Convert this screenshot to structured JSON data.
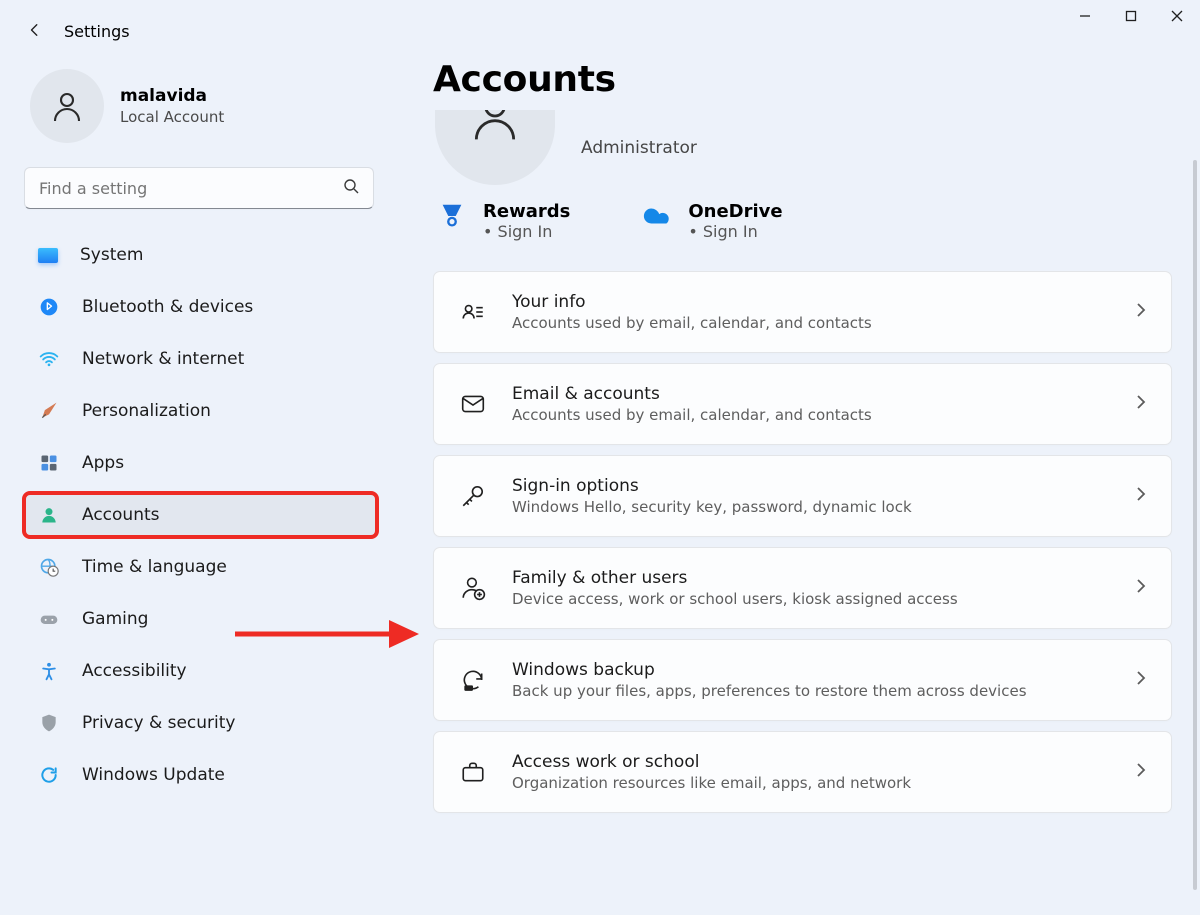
{
  "window": {
    "title": "Settings"
  },
  "user": {
    "name": "malavida",
    "type": "Local Account"
  },
  "search": {
    "placeholder": "Find a setting"
  },
  "nav": {
    "system": "System",
    "bluetooth": "Bluetooth & devices",
    "network": "Network & internet",
    "personalization": "Personalization",
    "apps": "Apps",
    "accounts": "Accounts",
    "time": "Time & language",
    "gaming": "Gaming",
    "accessibility": "Accessibility",
    "privacy": "Privacy & security",
    "update": "Windows Update"
  },
  "page": {
    "title": "Accounts",
    "role": "Administrator"
  },
  "tiles": {
    "rewards": {
      "title": "Rewards",
      "sub": "Sign In"
    },
    "onedrive": {
      "title": "OneDrive",
      "sub": "Sign In"
    }
  },
  "cards": {
    "info": {
      "title": "Your info",
      "sub": "Accounts used by email, calendar, and contacts"
    },
    "email": {
      "title": "Email & accounts",
      "sub": "Accounts used by email, calendar, and contacts"
    },
    "signin": {
      "title": "Sign-in options",
      "sub": "Windows Hello, security key, password, dynamic lock"
    },
    "family": {
      "title": "Family & other users",
      "sub": "Device access, work or school users, kiosk assigned access"
    },
    "backup": {
      "title": "Windows backup",
      "sub": "Back up your files, apps, preferences to restore them across devices"
    },
    "work": {
      "title": "Access work or school",
      "sub": "Organization resources like email, apps, and network"
    }
  }
}
